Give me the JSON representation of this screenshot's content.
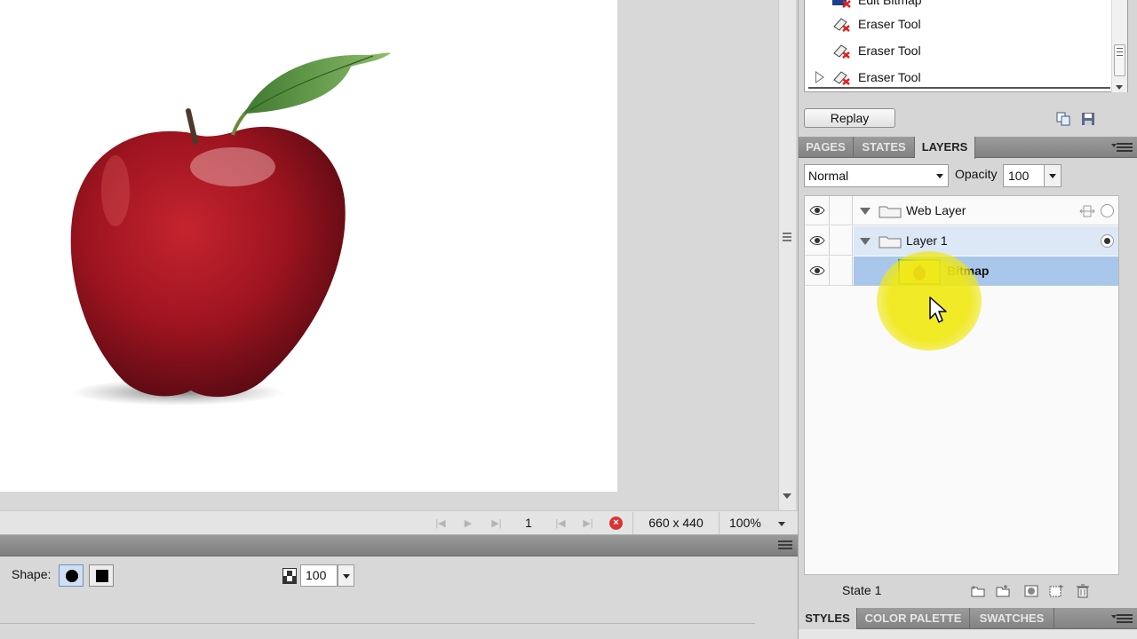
{
  "history": {
    "items": [
      {
        "label": "Edit Bitmap",
        "icon": "edit-bitmap-icon"
      },
      {
        "label": "Eraser Tool",
        "icon": "eraser-icon"
      },
      {
        "label": "Eraser Tool",
        "icon": "eraser-icon"
      },
      {
        "label": "Eraser Tool",
        "icon": "eraser-icon"
      }
    ],
    "replay_label": "Replay"
  },
  "panel_tabs": {
    "top": [
      {
        "label": "PAGES",
        "active": false
      },
      {
        "label": "STATES",
        "active": false
      },
      {
        "label": "LAYERS",
        "active": true
      }
    ],
    "bottom": [
      {
        "label": "STYLES",
        "active": true
      },
      {
        "label": "COLOR PALETTE",
        "active": false
      },
      {
        "label": "SWATCHES",
        "active": false
      }
    ]
  },
  "layers_panel": {
    "blend_mode": "Normal",
    "opacity_label": "Opacity",
    "opacity_value": "100",
    "layers": [
      {
        "name": "Web Layer",
        "type": "folder",
        "visible": true,
        "selected": false
      },
      {
        "name": "Layer 1",
        "type": "folder",
        "visible": true,
        "selected": false
      },
      {
        "name": "Bitmap",
        "type": "bitmap",
        "visible": true,
        "selected": true
      }
    ],
    "state_label": "State 1"
  },
  "status_bar": {
    "page_number": "1",
    "canvas_size": "660 x 440",
    "zoom": "100%"
  },
  "properties": {
    "shape_label": "Shape:",
    "opacity_value": "100"
  },
  "colors": {
    "selection": "#a9c7ea",
    "panel_header": "#8a8a8a",
    "cursor_highlight": "#f0e814",
    "stop_button": "#d93434"
  }
}
